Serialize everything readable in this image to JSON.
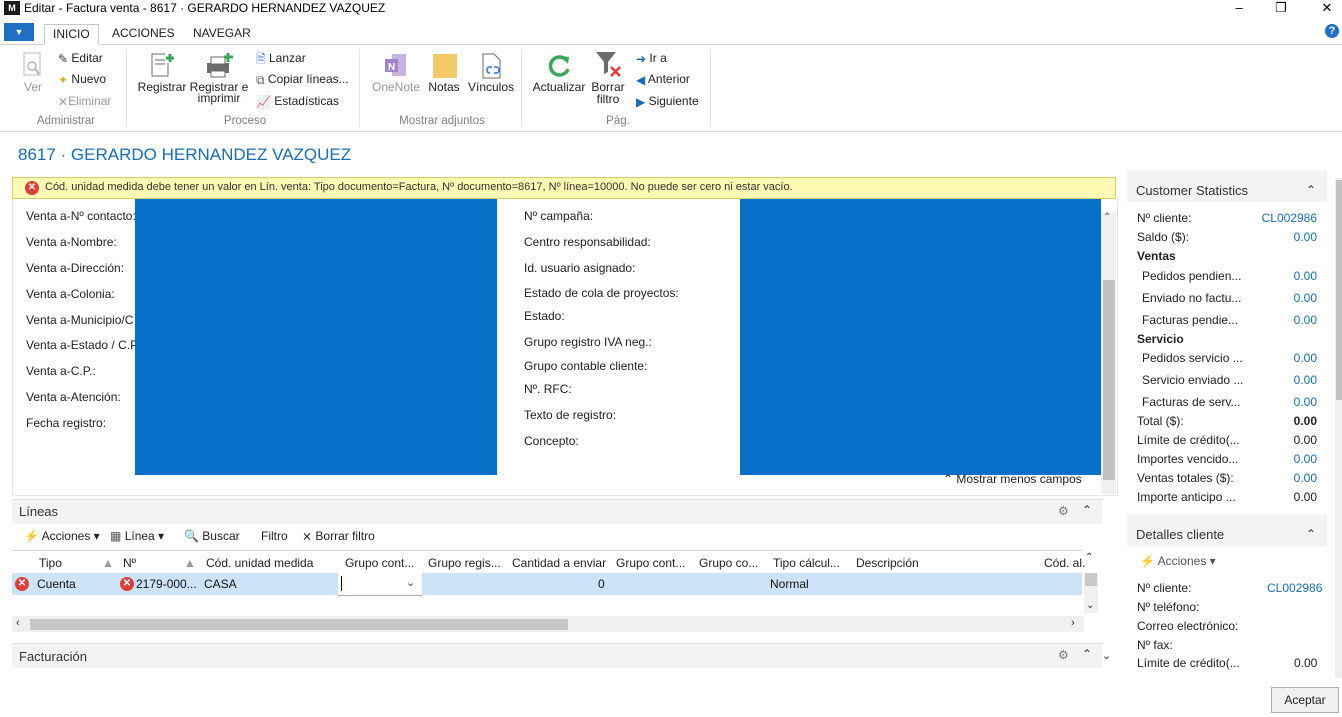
{
  "window": {
    "logo": "M",
    "title": "Editar - Factura venta - 8617 · GERARDO HERNANDEZ VAZQUEZ",
    "minimize": "–",
    "restore": "❐",
    "close": "✕"
  },
  "tabs": [
    "INICIO",
    "ACCIONES",
    "NAVEGAR"
  ],
  "ribbon": {
    "groups": {
      "administrar": {
        "label": "Administrar",
        "ver": "Ver",
        "editar": "Editar",
        "nuevo": "Nuevo",
        "eliminar": "Eliminar"
      },
      "proceso": {
        "label": "Proceso",
        "registrar": "Registrar",
        "registrar_imprimir_1": "Registrar e",
        "registrar_imprimir_2": "imprimir",
        "lanzar": "Lanzar",
        "copiar": "Copiar líneas...",
        "estadisticas": "Estadísticas"
      },
      "adjuntos": {
        "label": "Mostrar adjuntos",
        "onenote": "OneNote",
        "notas": "Notas",
        "vinculos": "Vínculos"
      },
      "pag": {
        "label": "Pág.",
        "actualizar": "Actualizar",
        "borrar_1": "Borrar",
        "borrar_2": "filtro",
        "ir_a": "Ir a",
        "anterior": "Anterior",
        "siguiente": "Siguiente"
      }
    }
  },
  "page_title": "8617 · GERARDO HERNANDEZ VAZQUEZ",
  "error_message": "Cód. unidad medida debe tener un valor en Lín. venta: Tipo documento=Factura, Nº documento=8617, Nº línea=10000. No puede ser cero ni estar vacío.",
  "general": {
    "left_fields": [
      "Venta a-Nº contacto:",
      "Venta a-Nombre:",
      "Venta a-Dirección:",
      "Venta a-Colonia:",
      "Venta a-Municipio/C",
      "Venta a-Estado / C.P.",
      "Venta a-C.P.:",
      "Venta a-Atención:",
      "Fecha registro:"
    ],
    "right_fields": [
      "Nº campaña:",
      "Centro responsabilidad:",
      "Id. usuario asignado:",
      "Estado de cola de proyectos:",
      "Estado:",
      "Grupo registro IVA neg.:",
      "Grupo contable cliente:",
      "Nº. RFC:",
      "Texto de registro:",
      "Concepto:"
    ],
    "show_less": "Mostrar menos campos"
  },
  "lines": {
    "title": "Líneas",
    "toolbar": {
      "acciones": "Acciones",
      "linea": "Línea",
      "buscar": "Buscar",
      "filtro": "Filtro",
      "borrar_filtro": "Borrar filtro"
    },
    "columns": [
      "Tipo",
      "Nº",
      "Cód. unidad medida",
      "Grupo cont...",
      "Grupo regis...",
      "Cantidad a enviar",
      "Grupo cont...",
      "Grupo co...",
      "Tipo cálcul...",
      "Descripción",
      "Cód. al."
    ],
    "row": {
      "tipo": "Cuenta",
      "no": "2179-000...",
      "unidad": "CASA",
      "cantidad": "0",
      "tipo_calculo": "Normal"
    }
  },
  "facturacion": {
    "title": "Facturación"
  },
  "customer_statistics": {
    "title": "Customer Statistics",
    "rows": [
      {
        "label": "Nº cliente:",
        "value": "CL002986",
        "link": true,
        "indent": false
      },
      {
        "label": "Saldo ($):",
        "value": "0.00",
        "link": true,
        "indent": false
      },
      {
        "label": "Ventas",
        "value": "",
        "header": true
      },
      {
        "label": "Pedidos pendien...",
        "value": "0.00",
        "link": true,
        "indent": true
      },
      {
        "label": "Enviado no factu...",
        "value": "0.00",
        "link": true,
        "indent": true
      },
      {
        "label": "Facturas pendie...",
        "value": "0.00",
        "link": true,
        "indent": true
      },
      {
        "label": "Servicio",
        "value": "",
        "header": true
      },
      {
        "label": "Pedidos servicio ...",
        "value": "0.00",
        "link": true,
        "indent": true
      },
      {
        "label": "Servicio enviado ...",
        "value": "0.00",
        "link": true,
        "indent": true
      },
      {
        "label": "Facturas de serv...",
        "value": "0.00",
        "link": true,
        "indent": true
      },
      {
        "label": "Total ($):",
        "value": "0.00",
        "bold": true
      },
      {
        "label": "Límite de crédito(...",
        "value": "0.00",
        "link": false
      },
      {
        "label": "Importes vencido...",
        "value": "0.00",
        "link": true
      },
      {
        "label": "Ventas totales ($):",
        "value": "0.00",
        "link": true
      },
      {
        "label": "Importe anticipo ...",
        "value": "0.00",
        "link": false
      }
    ]
  },
  "customer_details": {
    "title": "Detalles cliente",
    "acciones": "Acciones",
    "rows": [
      {
        "label": "Nº cliente:",
        "value": "CL002986",
        "link": true
      },
      {
        "label": "Nº teléfono:",
        "value": ""
      },
      {
        "label": "Correo electrónico:",
        "value": ""
      },
      {
        "label": "Nº fax:",
        "value": ""
      },
      {
        "label": "Límite de crédito(...",
        "value": "0.00",
        "link": false
      }
    ]
  },
  "accept_button": "Aceptar",
  "colors": {
    "accent": "#1a6db5",
    "redaction": "#0670c9",
    "error": "#d9413a",
    "warning_bg": "#fff9b3"
  }
}
